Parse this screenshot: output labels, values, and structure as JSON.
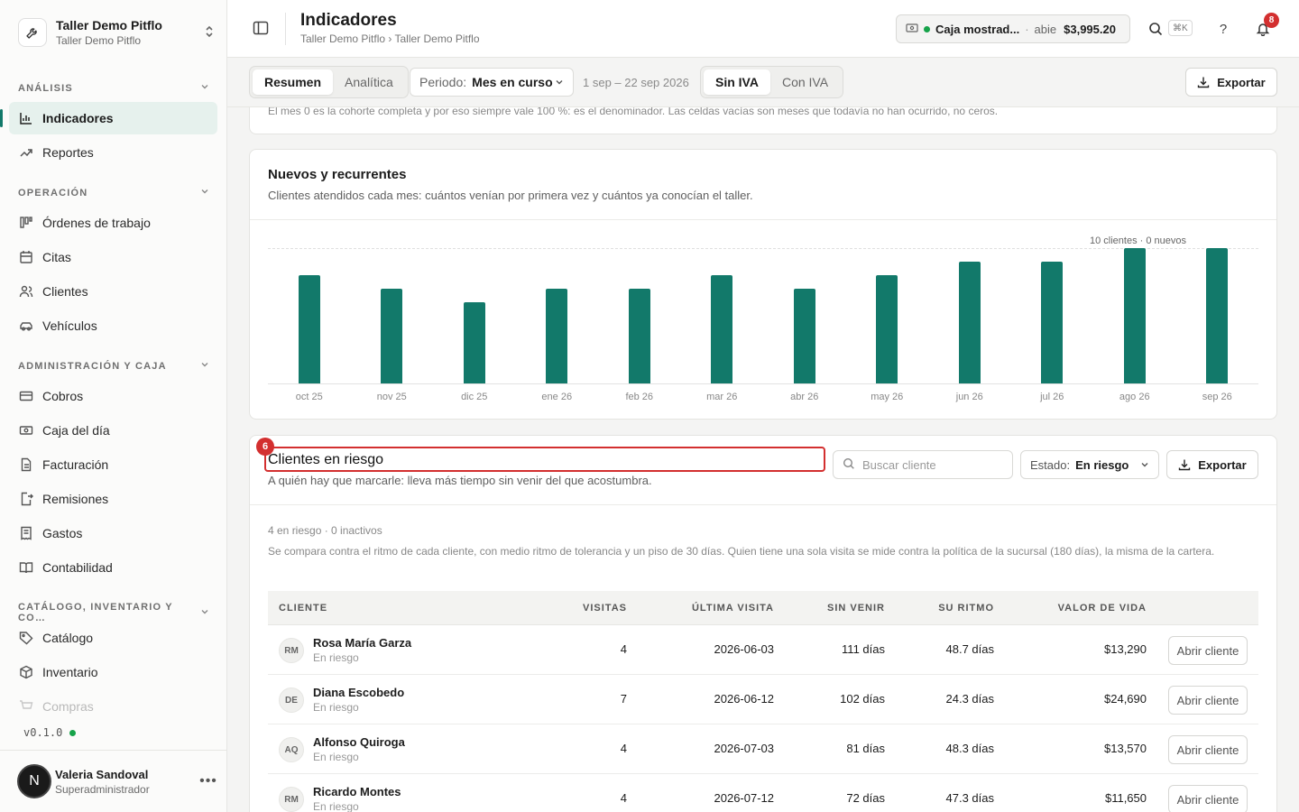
{
  "workspace": {
    "name": "Taller Demo Pitflo",
    "subtitle": "Taller Demo Pitflo"
  },
  "sidebar": {
    "sections": [
      {
        "label": "ANÁLISIS",
        "items": [
          "Indicadores",
          "Reportes"
        ]
      },
      {
        "label": "OPERACIÓN",
        "items": [
          "Órdenes de trabajo",
          "Citas",
          "Clientes",
          "Vehículos"
        ]
      },
      {
        "label": "ADMINISTRACIÓN Y CAJA",
        "items": [
          "Cobros",
          "Caja del día",
          "Facturación",
          "Remisiones",
          "Gastos",
          "Contabilidad"
        ]
      },
      {
        "label": "CATÁLOGO, INVENTARIO Y CO…",
        "items": [
          "Catálogo",
          "Inventario",
          "Compras"
        ]
      }
    ],
    "version": "v0.1.0",
    "user": {
      "initial": "N",
      "name": "Valeria Sandoval",
      "role": "Superadministrador"
    }
  },
  "header": {
    "title": "Indicadores",
    "breadcrumb": "Taller Demo Pitflo › Taller Demo Pitflo",
    "caja": {
      "name": "Caja mostrad...",
      "sep": "·",
      "state": "abie",
      "amount": "$3,995.20"
    },
    "kbd": "⌘K",
    "notifications": "8"
  },
  "toolbar": {
    "view_tabs": [
      "Resumen",
      "Analítica"
    ],
    "periodo_label": "Periodo:",
    "periodo_value": "Mes en curso",
    "range": "1 sep – 22 sep 2026",
    "iva_tabs": [
      "Sin IVA",
      "Con IVA"
    ],
    "export_label": "Exportar"
  },
  "cohort_note": "El mes 0 es la cohorte completa y por eso siempre vale 100 %: es el denominador. Las celdas vacías son meses que todavía no han ocurrido, no ceros.",
  "nuevos": {
    "title": "Nuevos y recurrentes",
    "subtitle": "Clientes atendidos cada mes: cuántos venían por primera vez y cuántos ya conocían el taller.",
    "caption": "10 clientes · 0 nuevos"
  },
  "chart_data": {
    "type": "bar",
    "categories": [
      "oct 25",
      "nov 25",
      "dic 25",
      "ene 26",
      "feb 26",
      "mar 26",
      "abr 26",
      "may 26",
      "jun 26",
      "jul 26",
      "ago 26",
      "sep 26"
    ],
    "values": [
      8,
      7,
      6,
      7,
      7,
      8,
      7,
      8,
      9,
      9,
      10,
      10
    ],
    "ylim": [
      0,
      10
    ],
    "grid": true,
    "color": "#12796a"
  },
  "riesgo": {
    "badge": "6",
    "title": "Clientes en riesgo",
    "subtitle": "A quién hay que marcarle: lleva más tiempo sin venir del que acostumbra.",
    "search_placeholder": "Buscar cliente",
    "estado_label": "Estado:",
    "estado_value": "En riesgo",
    "export_label": "Exportar",
    "meta": "4 en riesgo · 0 inactivos",
    "explain": "Se compara contra el ritmo de cada cliente, con medio ritmo de tolerancia y un piso de 30 días. Quien tiene una sola visita se mide contra la política de la sucursal (180 días), la misma de la cartera.",
    "columns": [
      "CLIENTE",
      "VISITAS",
      "ÚLTIMA VISITA",
      "SIN VENIR",
      "SU RITMO",
      "VALOR DE VIDA"
    ],
    "open_label": "Abrir cliente",
    "rows": [
      {
        "initials": "RM",
        "name": "Rosa María Garza",
        "status": "En riesgo",
        "visits": "4",
        "last": "2026-06-03",
        "since": "111 días",
        "rhythm": "48.7 días",
        "value": "$13,290"
      },
      {
        "initials": "DE",
        "name": "Diana Escobedo",
        "status": "En riesgo",
        "visits": "7",
        "last": "2026-06-12",
        "since": "102 días",
        "rhythm": "24.3 días",
        "value": "$24,690"
      },
      {
        "initials": "AQ",
        "name": "Alfonso Quiroga",
        "status": "En riesgo",
        "visits": "4",
        "last": "2026-07-03",
        "since": "81 días",
        "rhythm": "48.3 días",
        "value": "$13,570"
      },
      {
        "initials": "RM",
        "name": "Ricardo Montes",
        "status": "En riesgo",
        "visits": "4",
        "last": "2026-07-12",
        "since": "72 días",
        "rhythm": "47.3 días",
        "value": "$11,650"
      }
    ]
  },
  "colors": {
    "accent": "#12796a",
    "alert": "#d32f2f",
    "online": "#16a34a"
  }
}
